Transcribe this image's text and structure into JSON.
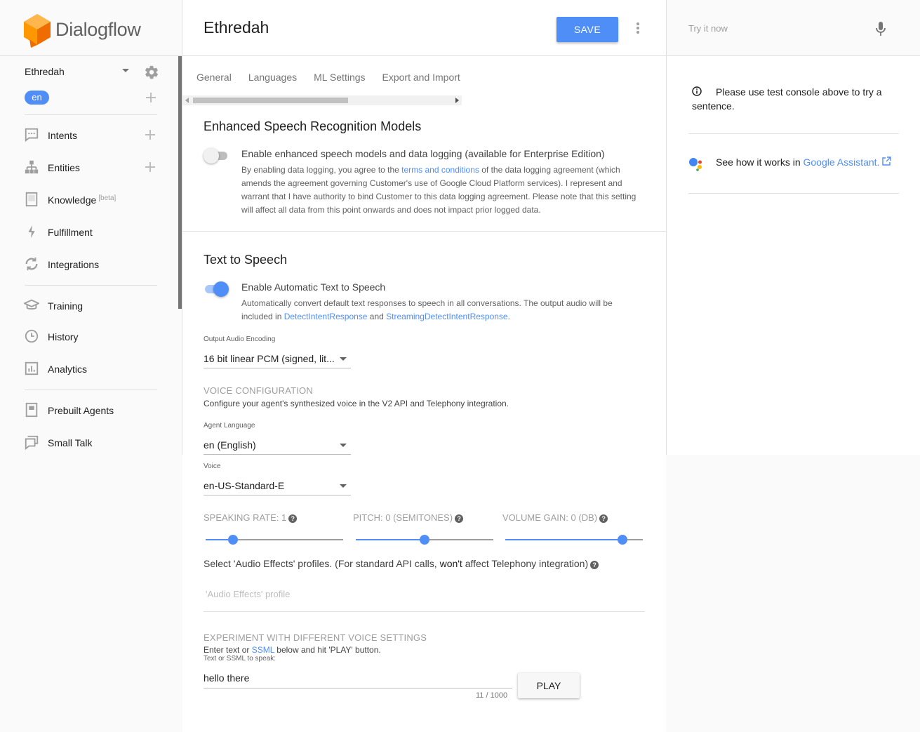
{
  "brand": {
    "name": "Dialogflow"
  },
  "sidebar": {
    "agent_name": "Ethredah",
    "language_chip": "en",
    "items": [
      {
        "label": "Intents",
        "icon": "chat-bubble-icon",
        "has_add": true
      },
      {
        "label": "Entities",
        "icon": "hierarchy-icon",
        "has_add": true
      },
      {
        "label": "Knowledge",
        "icon": "book-icon",
        "beta": "[beta]"
      },
      {
        "label": "Fulfillment",
        "icon": "bolt-icon"
      },
      {
        "label": "Integrations",
        "icon": "sync-icon"
      },
      {
        "label": "Training",
        "icon": "graduation-cap-icon"
      },
      {
        "label": "History",
        "icon": "clock-icon"
      },
      {
        "label": "Analytics",
        "icon": "bar-chart-icon"
      },
      {
        "label": "Prebuilt Agents",
        "icon": "agent-book-icon"
      },
      {
        "label": "Small Talk",
        "icon": "chat-bubbles-icon"
      }
    ]
  },
  "header": {
    "title": "Ethredah",
    "save_label": "SAVE"
  },
  "tabs": [
    "General",
    "Languages",
    "ML Settings",
    "Export and Import"
  ],
  "speech_models": {
    "title": "Enhanced Speech Recognition Models",
    "toggle_label": "Enable enhanced speech models and data logging (available for Enterprise Edition)",
    "toggle_on": false,
    "desc_pre": "By enabling data logging, you agree to the ",
    "desc_link": "terms and conditions",
    "desc_post": " of the data logging agreement (which amends the agreement governing Customer's use of Google Cloud Platform services). I represent and warrant that I have authority to bind Customer to this data logging agreement. Please note that this setting will affect all data from this point onwards and does not impact prior logged data."
  },
  "tts": {
    "title": "Text to Speech",
    "toggle_label": "Enable Automatic Text to Speech",
    "toggle_on": true,
    "desc_pre": "Automatically convert default text responses to speech in all conversations. The output audio will be included in ",
    "link1": "DetectIntentResponse",
    "desc_mid": " and ",
    "link2": "StreamingDetectIntentResponse",
    "desc_post": ".",
    "encoding_label": "Output Audio Encoding",
    "encoding_value": "16 bit linear PCM (signed, lit...",
    "voice_config_head": "VOICE CONFIGURATION",
    "voice_config_desc": "Configure your agent's synthesized voice in the V2 API and Telephony integration.",
    "agent_language_label": "Agent Language",
    "agent_language_value": "en (English)",
    "voice_label": "Voice",
    "voice_value": "en-US-Standard-E",
    "sliders": [
      {
        "label": "SPEAKING RATE: 1",
        "fraction": 0.2
      },
      {
        "label": "PITCH: 0 (SEMITONES)",
        "fraction": 0.5
      },
      {
        "label": "VOLUME GAIN: 0 (DB)",
        "fraction": 0.85
      }
    ],
    "help_glyph": "?",
    "audio_effects_pre": "Select 'Audio Effects' profiles. (For standard API calls, ",
    "audio_effects_bold": "won't",
    "audio_effects_post": " affect Telephony integration)",
    "audio_effects_placeholder": "'Audio Effects' profile",
    "experiment_head": "EXPERIMENT WITH DIFFERENT VOICE SETTINGS",
    "experiment_pre": "Enter text or ",
    "experiment_link": "SSML",
    "experiment_post": " below and hit 'PLAY' button.",
    "speak_label": "Text or SSML to speak:",
    "speak_value": "hello there",
    "speak_count": "11 / 1000",
    "play_label": "PLAY"
  },
  "right_panel": {
    "try_placeholder": "Try it now",
    "info_text": "Please use test console above to try a sentence.",
    "ga_pre": "See how it works in ",
    "ga_link": "Google Assistant."
  },
  "colors": {
    "accent": "#4f8ef7",
    "logo_orange": "#ff9800"
  }
}
